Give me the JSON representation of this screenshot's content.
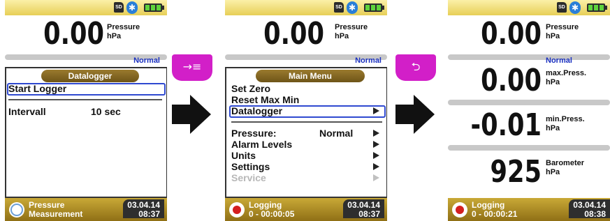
{
  "screens": [
    {
      "status": {
        "sd": "SD",
        "bt_icon": "bluetooth-icon",
        "battery_icon": "battery-icon"
      },
      "reading": {
        "value": "0.00",
        "label": "Pressure",
        "unit": "hPa",
        "mode": "Normal"
      },
      "menu_title": "Datalogger",
      "items": [
        {
          "label": "Start Logger"
        },
        {
          "label": "Intervall",
          "value": "10 sec"
        }
      ],
      "footer": {
        "line1": "Pressure",
        "line2": "Measurement",
        "date": "03.04.14",
        "time": "08:37"
      }
    },
    {
      "status": {
        "sd": "SD",
        "bt_icon": "bluetooth-icon",
        "battery_icon": "battery-icon"
      },
      "reading": {
        "value": "0.00",
        "label": "Pressure",
        "unit": "hPa",
        "mode": "Normal"
      },
      "menu_title": "Main Menu",
      "items": [
        {
          "label": "Set Zero"
        },
        {
          "label": "Reset Max Min"
        },
        {
          "label": "Datalogger"
        },
        {
          "label": "Pressure:",
          "value": "Normal"
        },
        {
          "label": "Alarm Levels"
        },
        {
          "label": "Units"
        },
        {
          "label": "Settings"
        },
        {
          "label": "Service"
        }
      ],
      "footer": {
        "line1": "Logging",
        "line2": "0 - 00:00:05",
        "date": "03.04.14",
        "time": "08:37"
      }
    },
    {
      "status": {
        "sd": "SD",
        "bt_icon": "bluetooth-icon",
        "battery_icon": "battery-icon"
      },
      "readings": [
        {
          "value": "0.00",
          "label": "Pressure",
          "unit": "hPa",
          "mode": "Normal"
        },
        {
          "value": "0.00",
          "label": "max.Press.",
          "unit": "hPa"
        },
        {
          "value": "-0.01",
          "label": "min.Press.",
          "unit": "hPa"
        },
        {
          "value": "925",
          "label": "Barometer",
          "unit": "hPa"
        }
      ],
      "footer": {
        "line1": "Logging",
        "line2": "0 - 00:00:21",
        "date": "03.04.14",
        "time": "08:38"
      }
    }
  ],
  "keys": [
    {
      "icon": "enter-menu-icon",
      "glyph": "→≡"
    },
    {
      "icon": "back-icon",
      "glyph": "⮌"
    }
  ],
  "arrows": [
    {
      "icon": "right-arrow-icon"
    },
    {
      "icon": "right-arrow-icon"
    }
  ],
  "colors": {
    "header": "#e7cf57",
    "footer": "#8f6f16",
    "selection": "#2f49d0",
    "mode_text": "#1a30c0",
    "softkey": "#d21fc8"
  }
}
